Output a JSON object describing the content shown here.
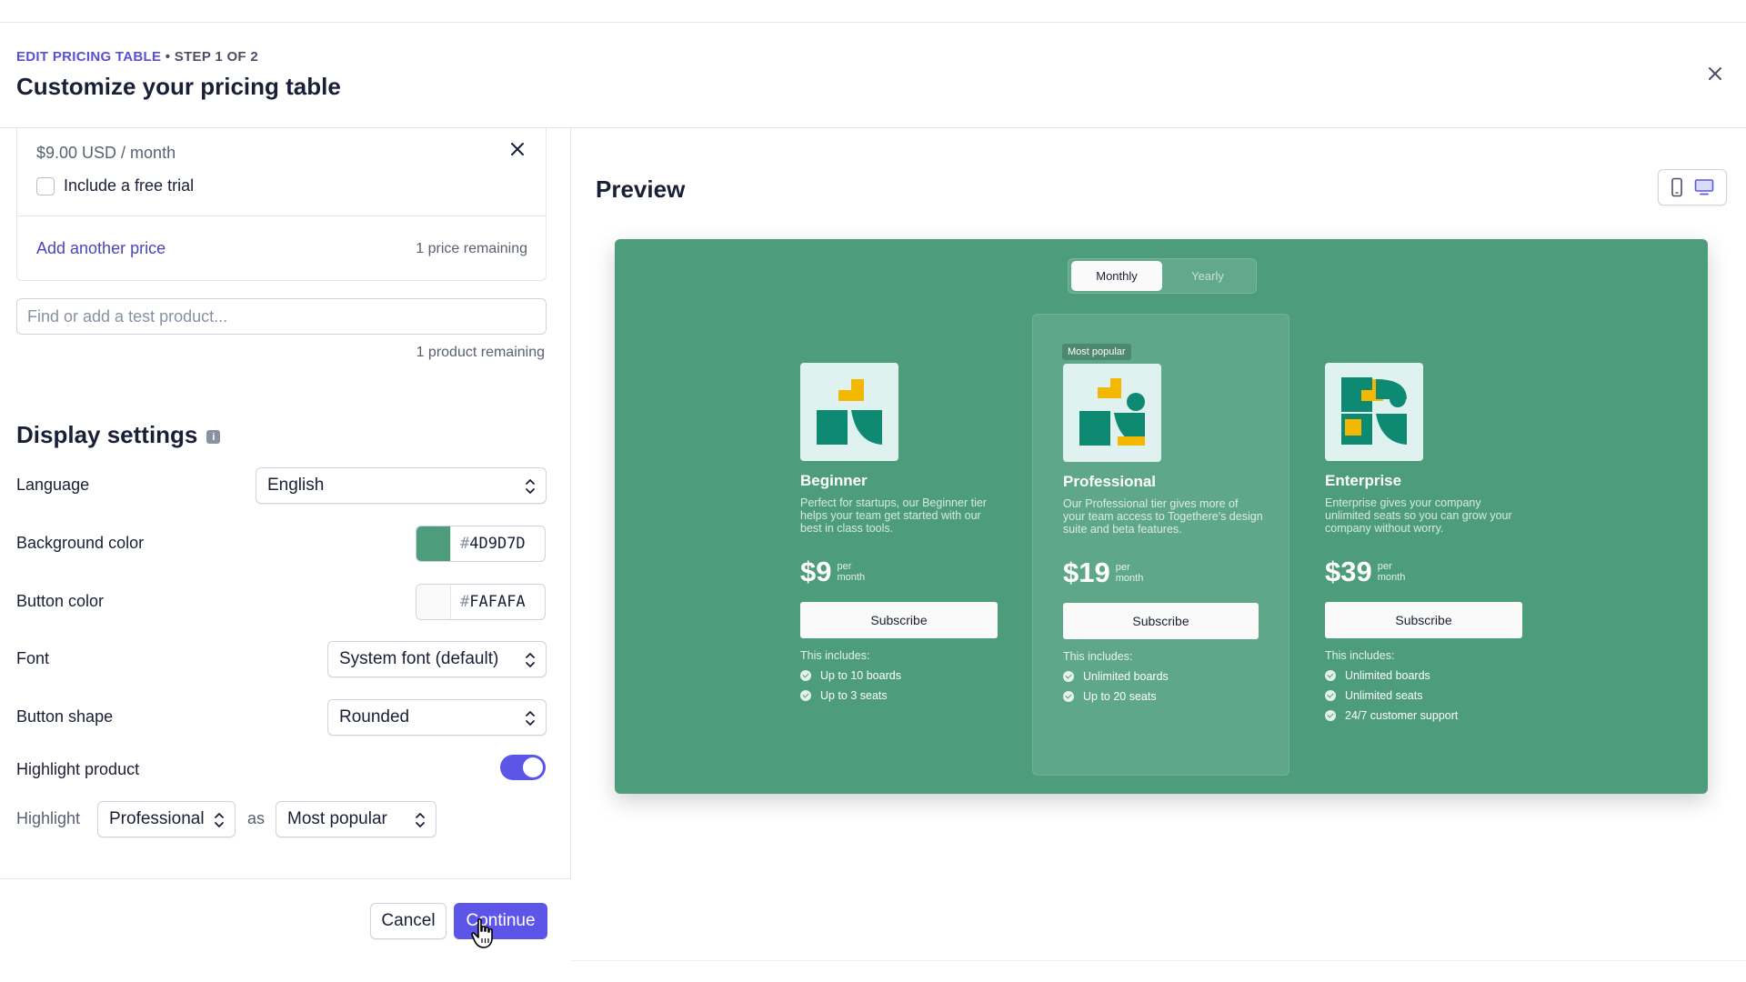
{
  "header": {
    "breadcrumb_accent": "EDIT PRICING TABLE",
    "breadcrumb_rest": " • STEP 1 OF 2",
    "title": "Customize your pricing table"
  },
  "price_card": {
    "price": "$9.00 USD / month",
    "trial_label": "Include a free trial",
    "add_price": "Add another price",
    "remaining": "1 price remaining"
  },
  "product_search": {
    "placeholder": "Find or add a test product...",
    "remaining": "1 product remaining"
  },
  "display": {
    "title": "Display settings",
    "info_icon": "i",
    "language_label": "Language",
    "language_value": "English",
    "bg_label": "Background color",
    "bg_value": "4D9D7D",
    "bg_color": "#4D9D7D",
    "button_color_label": "Button color",
    "button_color_value": "FAFAFA",
    "button_color": "#FAFAFA",
    "font_label": "Font",
    "font_value": "System font (default)",
    "shape_label": "Button shape",
    "shape_value": "Rounded",
    "highlight_label": "Highlight product",
    "highlight_enabled": true,
    "highlight_prefix": "Highlight",
    "highlight_product": "Professional",
    "highlight_as": "as",
    "highlight_badge": "Most popular"
  },
  "footer": {
    "cancel": "Cancel",
    "continue": "Continue"
  },
  "preview": {
    "title": "Preview",
    "device_icons": [
      "mobile-icon",
      "desktop-icon"
    ],
    "toggle": {
      "monthly": "Monthly",
      "yearly": "Yearly",
      "selected": "Monthly"
    },
    "badge": "Most popular",
    "includes_label": "This includes:",
    "plans": [
      {
        "name": "Beginner",
        "description": "Perfect for startups, our Beginner tier helps your team get started with our best in class tools.",
        "price": "$9",
        "unit": "per month",
        "button": "Subscribe",
        "features": [
          "Up to 10 boards",
          "Up to 3 seats"
        ]
      },
      {
        "name": "Professional",
        "description": "Our Professional tier gives more of your team access to Togethere's design suite and beta features.",
        "price": "$19",
        "unit": "per month",
        "button": "Subscribe",
        "features": [
          "Unlimited boards",
          "Up to 20 seats"
        ]
      },
      {
        "name": "Enterprise",
        "description": "Enterprise gives your company unlimited seats so you can grow your company without worry.",
        "price": "$39",
        "unit": "per month",
        "button": "Subscribe",
        "features": [
          "Unlimited boards",
          "Unlimited seats",
          "24/7 customer support"
        ]
      }
    ]
  },
  "colors": {
    "accent": "#5D55E8",
    "link": "#4B46B8",
    "illustration_teal": "#0E8A72",
    "illustration_yellow": "#F5B800"
  }
}
